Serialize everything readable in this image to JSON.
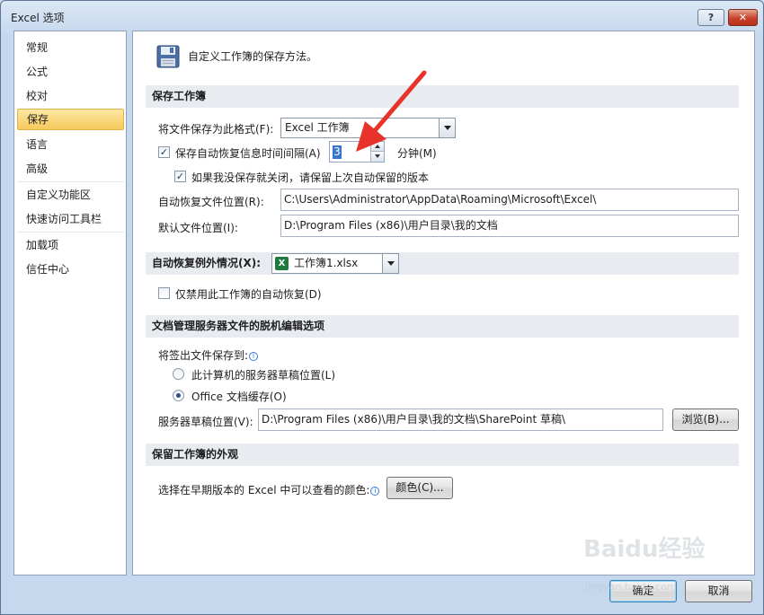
{
  "window": {
    "title": "Excel 选项",
    "help_label": "?",
    "close_label": "✕"
  },
  "nav": {
    "items": [
      "常规",
      "公式",
      "校对",
      "保存",
      "语言",
      "高级",
      "自定义功能区",
      "快速访问工具栏",
      "加载项",
      "信任中心"
    ],
    "active": "保存"
  },
  "header": {
    "text": "自定义工作簿的保存方法。",
    "icon": "floppy-disk-icon"
  },
  "save_workbooks": {
    "title": "保存工作簿",
    "format_label": "将文件保存为此格式(F):",
    "format_value": "Excel 工作簿",
    "autorecover_label": "保存自动恢复信息时间间隔(A)",
    "autorecover_checked": true,
    "autorecover_minutes": "3",
    "minutes_label": "分钟(M)",
    "keep_last_label": "如果我没保存就关闭，请保留上次自动保留的版本",
    "keep_last_checked": true,
    "autorecover_location_label": "自动恢复文件位置(R):",
    "autorecover_location_value": "C:\\Users\\Administrator\\AppData\\Roaming\\Microsoft\\Excel\\",
    "default_location_label": "默认文件位置(I):",
    "default_location_value": "D:\\Program Files (x86)\\用户目录\\我的文档"
  },
  "autorecover_exceptions": {
    "title": "自动恢复例外情况(X):",
    "workbook_value": "工作簿1.xlsx",
    "disable_label": "仅禁用此工作簿的自动恢复(D)",
    "disable_checked": false
  },
  "offline_editing": {
    "title": "文档管理服务器文件的脱机编辑选项",
    "save_checked_out_label": "将签出文件保存到:",
    "option_server_drafts": "此计算机的服务器草稿位置(L)",
    "option_office_cache": "Office 文档缓存(O)",
    "selected": "Office 文档缓存(O)",
    "drafts_location_label": "服务器草稿位置(V):",
    "drafts_location_value": "D:\\Program Files (x86)\\用户目录\\我的文档\\SharePoint 草稿\\",
    "browse_label": "浏览(B)..."
  },
  "appearance": {
    "title": "保留工作簿的外观",
    "colors_label": "选择在早期版本的 Excel 中可以查看的颜色:",
    "colors_button": "颜色(C)..."
  },
  "footer": {
    "ok_label": "确定",
    "cancel_label": "取消"
  },
  "watermark": {
    "text": "Baidu经验",
    "sub": "jingyan.baidu.com"
  },
  "colors": {
    "annotation_arrow": "#e8332a",
    "active_nav": "#f6c95a"
  }
}
